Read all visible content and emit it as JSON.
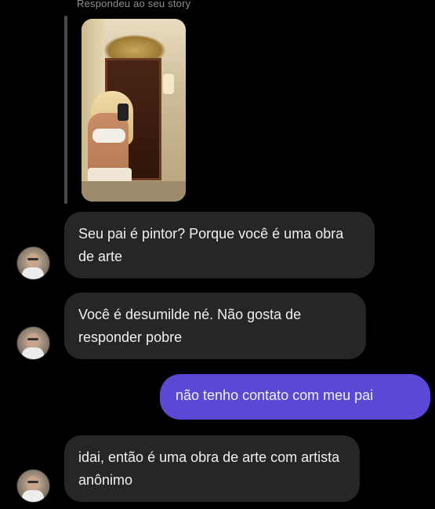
{
  "story": {
    "caption": "Respondeu ao seu story"
  },
  "messages": [
    {
      "side": "in",
      "text": "Seu pai é pintor? Porque você é uma obra de arte"
    },
    {
      "side": "in",
      "text": "Você é desumilde né. Não gosta de responder pobre"
    },
    {
      "side": "out",
      "text": "não tenho contato com meu pai"
    },
    {
      "side": "in",
      "text": "idai, então é uma obra de arte com artista anônimo"
    }
  ],
  "colors": {
    "background": "#000000",
    "incoming_bubble": "#262626",
    "outgoing_bubble": "#5b49d6",
    "caption": "#8e8e8e"
  },
  "icons": {
    "avatar": "profile-avatar",
    "story_preview": "story-image-thumbnail"
  }
}
